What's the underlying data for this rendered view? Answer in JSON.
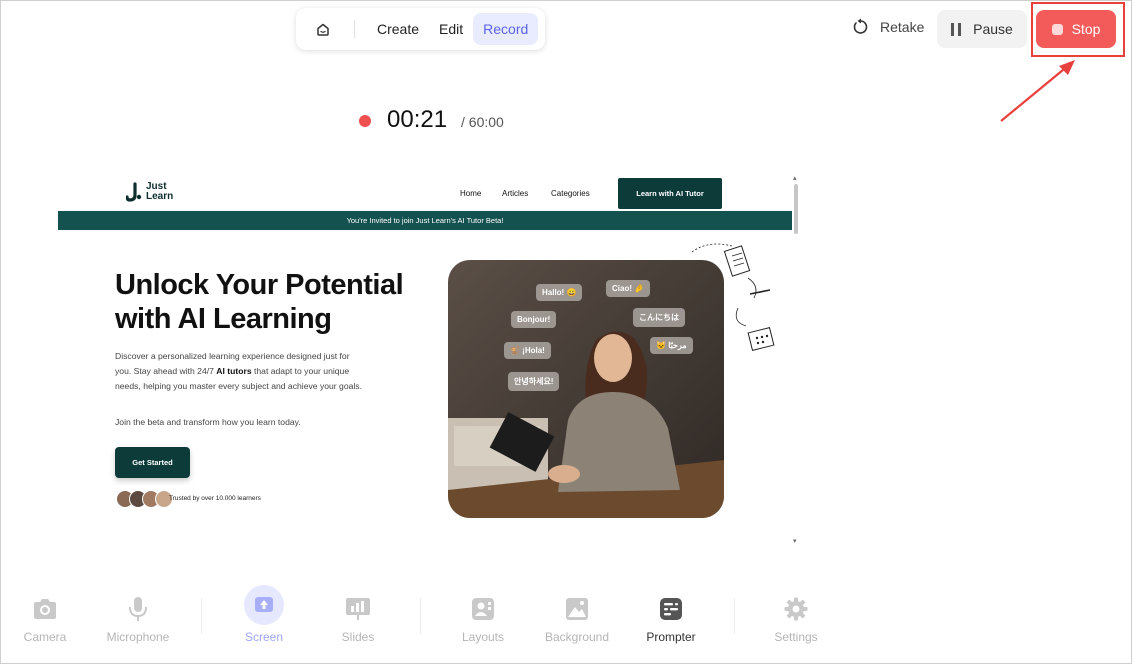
{
  "toolbar": {
    "modes": [
      "Create",
      "Edit",
      "Record"
    ],
    "active_mode": "Record",
    "retake_label": "Retake",
    "pause_label": "Pause",
    "stop_label": "Stop"
  },
  "recording": {
    "elapsed": "00:21",
    "limit": "/ 60:00"
  },
  "preview": {
    "logo_line1": "Just",
    "logo_line2": "Learn",
    "nav": [
      "Home",
      "Articles",
      "Categories"
    ],
    "cta_top": "Learn with AI Tutor",
    "banner": "You're Invited to join Just Learn's AI Tutor Beta!",
    "hero_title_1": "Unlock Your Potential",
    "hero_title_2": "with AI Learning",
    "desc_1": "Discover a personalized learning experience designed just for you. Stay ahead with 24/7 ",
    "desc_bold": "AI tutors",
    "desc_2": " that adapt to your unique needs, helping you master every subject and achieve your goals.",
    "join": "Join the beta and transform how you learn today.",
    "get_started": "Get Started",
    "trusted": "Trusted by over 10.000 learners",
    "bubbles": [
      "Hallo! 😀",
      "Ciao! 🤌",
      "Bonjour!",
      "こんにちは",
      "🐒 ¡Hola!",
      "🐱 مرحبًا",
      "안녕하세요!"
    ]
  },
  "bottom_tools": {
    "camera": "Camera",
    "microphone": "Microphone",
    "screen": "Screen",
    "slides": "Slides",
    "layouts": "Layouts",
    "background": "Background",
    "prompter": "Prompter",
    "settings": "Settings"
  },
  "colors": {
    "accent": "#5a63e6",
    "stop": "#f35b5b",
    "highlight": "#e8403c",
    "site_dark": "#0c3b3a"
  }
}
